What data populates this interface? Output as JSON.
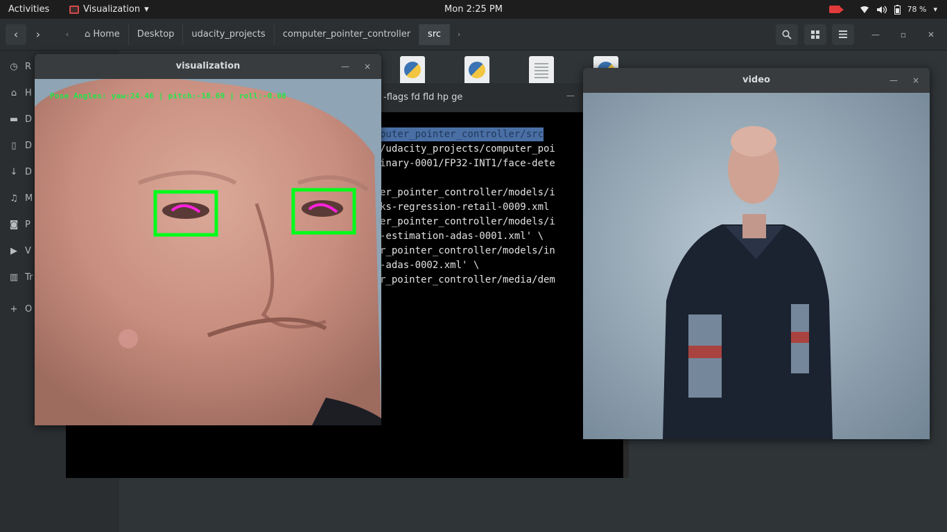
{
  "topbar": {
    "activities": "Activities",
    "app_name": "Visualization",
    "app_menu_arrow": "▾",
    "clock": "Mon  2:25 PM",
    "battery": "78 %"
  },
  "file_manager": {
    "nav_back": "‹",
    "nav_forward": "›",
    "crumb_left_arrow": "‹",
    "crumb_right_arrow": "›",
    "breadcrumbs": [
      "Home",
      "Desktop",
      "udacity_projects",
      "computer_pointer_controller",
      "src"
    ],
    "sidebar_labels": [
      "R",
      "H",
      "D",
      "D",
      "D",
      "M",
      "P",
      "V",
      "Tr",
      "O"
    ]
  },
  "terminal": {
    "title": "-flags fd fld hp ge",
    "menu": "—",
    "lines": [
      "puter_pointer_controller/src",
      "/udacity_projects/computer_poi",
      "inary-0001/FP32-INT1/face-dete",
      "",
      "er_pointer_controller/models/i",
      "ks-regression-retail-0009.xml",
      "er_pointer_controller/models/i",
      "-estimation-adas-0001.xml' \\",
      "r_pointer_controller/models/in",
      "-adas-0002.xml' \\",
      "r_pointer_controller/media/dem"
    ]
  },
  "visualization_window": {
    "title": "visualization",
    "minimize": "—",
    "close": "×",
    "pose_text": "Pose Angles: yaw:24.46 | pitch:-18.69 | roll:-0.08",
    "overlay_color": "#00ff1a",
    "gaze_color": "#ff22dd"
  },
  "video_window": {
    "title": "video",
    "minimize": "—",
    "close": "×"
  },
  "colors": {
    "desktop_bg": "#2f3437",
    "topbar_bg": "#1d1d1d",
    "selection": "#4a6fa5"
  }
}
